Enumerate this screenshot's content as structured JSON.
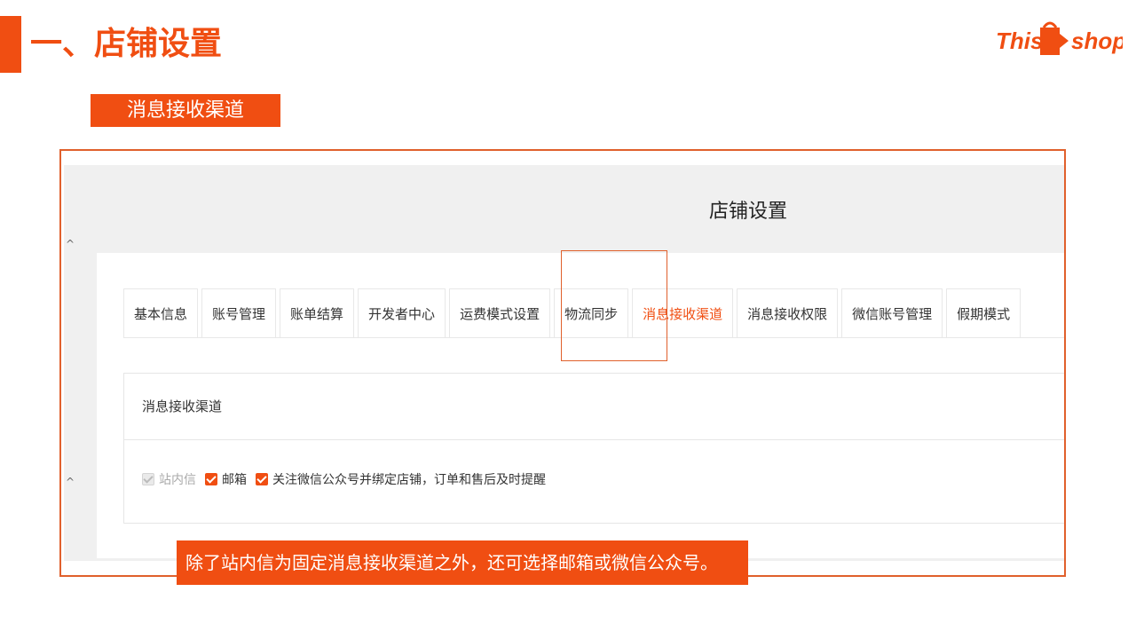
{
  "header": {
    "title": "一、店铺设置",
    "logo_text_left": "This",
    "logo_text_right": "shop"
  },
  "section_tag": "消息接收渠道",
  "screenshot": {
    "page_title": "店铺设置",
    "tabs": [
      {
        "label": "基本信息",
        "active": false
      },
      {
        "label": "账号管理",
        "active": false
      },
      {
        "label": "账单结算",
        "active": false
      },
      {
        "label": "开发者中心",
        "active": false
      },
      {
        "label": "运费模式设置",
        "active": false
      },
      {
        "label": "物流同步",
        "active": false
      },
      {
        "label": "消息接收渠道",
        "active": true
      },
      {
        "label": "消息接收权限",
        "active": false
      },
      {
        "label": "微信账号管理",
        "active": false
      },
      {
        "label": "假期模式",
        "active": false
      }
    ],
    "card_title": "消息接收渠道",
    "options": [
      {
        "label": "站内信",
        "checked": true,
        "disabled": true
      },
      {
        "label": "邮箱",
        "checked": true,
        "disabled": false
      },
      {
        "label": "关注微信公众号并绑定店铺，订单和售后及时提醒",
        "checked": true,
        "disabled": false
      }
    ]
  },
  "note": "除了站内信为固定消息接收渠道之外，还可选择邮箱或微信公众号。",
  "colors": {
    "accent": "#f04e12",
    "frame": "#e0602c"
  }
}
